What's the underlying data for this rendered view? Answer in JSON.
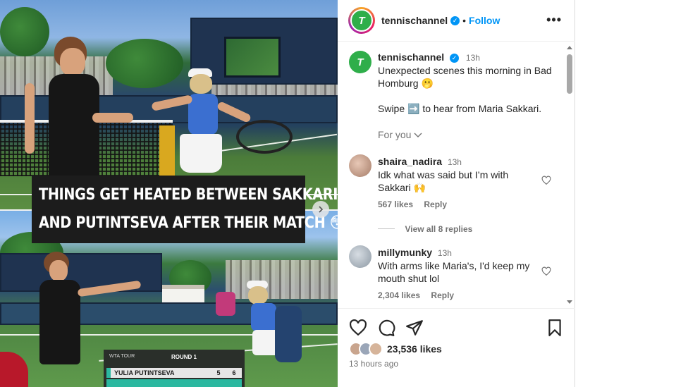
{
  "media": {
    "caption_line1": "THINGS GET HEATED BETWEEN SAKKARI",
    "caption_line2": "AND PUTINTSEVA AFTER THEIR MATCH 😳",
    "next_icon": "chevron-right-icon",
    "scoreboard": {
      "tour": "WTA TOUR",
      "round": "ROUND 1",
      "player1": "YULIA PUTINTSEVA",
      "p1_set1": "5",
      "p1_set2": "6"
    }
  },
  "header": {
    "username": "tennischannel",
    "avatar_letter": "T",
    "separator": "•",
    "follow_label": "Follow",
    "more_icon": "more-horizontal-icon"
  },
  "post": {
    "username": "tennischannel",
    "time": "13h",
    "line1": "Unexpected scenes this morning in Bad",
    "line2": "Homburg 🫢",
    "line3": "Swipe ➡️ to hear from Maria Sakkari.",
    "for_you": "For you"
  },
  "comments": [
    {
      "username": "shaira_nadira",
      "time": "13h",
      "line1": "Idk what was said but I’m with",
      "line2": "Sakkari 🙌",
      "likes": "567 likes",
      "reply": "Reply",
      "view_replies": "View all 8 replies"
    },
    {
      "username": "millymunky",
      "time": "13h",
      "line1": "With arms like Maria's, I'd keep my",
      "line2": "mouth shut lol",
      "likes": "2,304 likes",
      "reply": "Reply"
    }
  ],
  "footer": {
    "likes": "23,536 likes",
    "time_ago": "13 hours ago"
  },
  "colors": {
    "accent": "#0095f6",
    "brand": "#2fae4a",
    "text": "#262626",
    "muted": "#737373"
  }
}
